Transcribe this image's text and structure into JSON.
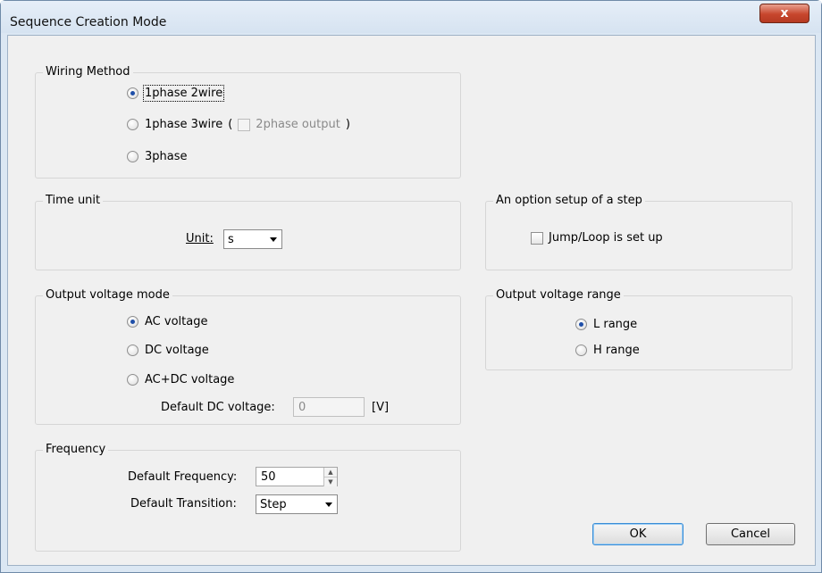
{
  "window": {
    "title": "Sequence Creation Mode",
    "close_glyph": "x"
  },
  "wiring": {
    "title": "Wiring Method",
    "options": [
      "1phase 2wire",
      "1phase 3wire",
      "3phase"
    ],
    "selected": "1phase 2wire",
    "paren_open": "(",
    "paren_close": ")",
    "two_phase_label": "2phase output"
  },
  "time_unit": {
    "title": "Time unit",
    "unit_label": "Unit:",
    "unit_value": "s"
  },
  "step_option": {
    "title": "An option setup of a step",
    "jump_loop_label": "Jump/Loop is set up"
  },
  "output_mode": {
    "title": "Output voltage mode",
    "options": [
      "AC voltage",
      "DC voltage",
      "AC+DC voltage"
    ],
    "selected": "AC voltage",
    "default_dc_label": "Default DC voltage:",
    "default_dc_value": "0",
    "unit": "[V]"
  },
  "range": {
    "title": "Output voltage range",
    "options": [
      "L range",
      "H range"
    ],
    "selected": "L range"
  },
  "frequency": {
    "title": "Frequency",
    "default_freq_label": "Default Frequency:",
    "default_freq_value": "50",
    "default_transition_label": "Default Transition:",
    "default_transition_value": "Step"
  },
  "buttons": {
    "ok": "OK",
    "cancel": "Cancel"
  },
  "icons": {
    "spin_up": "▲",
    "spin_down": "▼"
  }
}
